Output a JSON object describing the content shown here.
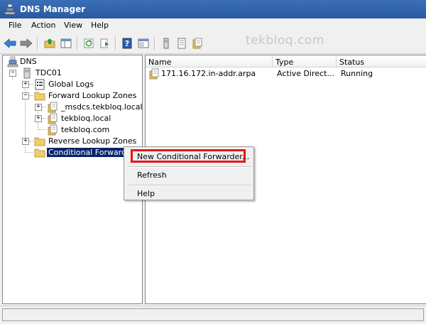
{
  "window": {
    "title": "DNS Manager"
  },
  "menu": [
    "File",
    "Action",
    "View",
    "Help"
  ],
  "watermark": "tekbloq.com",
  "toolbar": {
    "buttons": [
      "back-arrow-icon",
      "forward-arrow-icon",
      "up-folder-icon",
      "show-hide-tree-icon",
      "refresh-icon",
      "export-list-icon",
      "help-icon",
      "properties-icon",
      "server-icon",
      "zone-list-icon",
      "new-zone-icon"
    ]
  },
  "tree": {
    "root": "DNS",
    "server": "TDC01",
    "global_logs": "Global Logs",
    "forward_zones": "Forward Lookup Zones",
    "msdcs": "_msdcs.tekbloq.local",
    "tekbloq_local": "tekbloq.local",
    "tekbloq_com": "tekbloq.com",
    "reverse_zones": "Reverse Lookup Zones",
    "conditional_forwarders": "Conditional Forwarders"
  },
  "list": {
    "columns": [
      "Name",
      "Type",
      "Status"
    ],
    "rows": [
      {
        "name": "171.16.172.in-addr.arpa",
        "type": "Active Direct...",
        "status": "Running"
      }
    ]
  },
  "context_menu": {
    "items": [
      "New Conditional Forwarder...",
      "Refresh",
      "Help"
    ],
    "highlight_color": "#e4161b"
  }
}
